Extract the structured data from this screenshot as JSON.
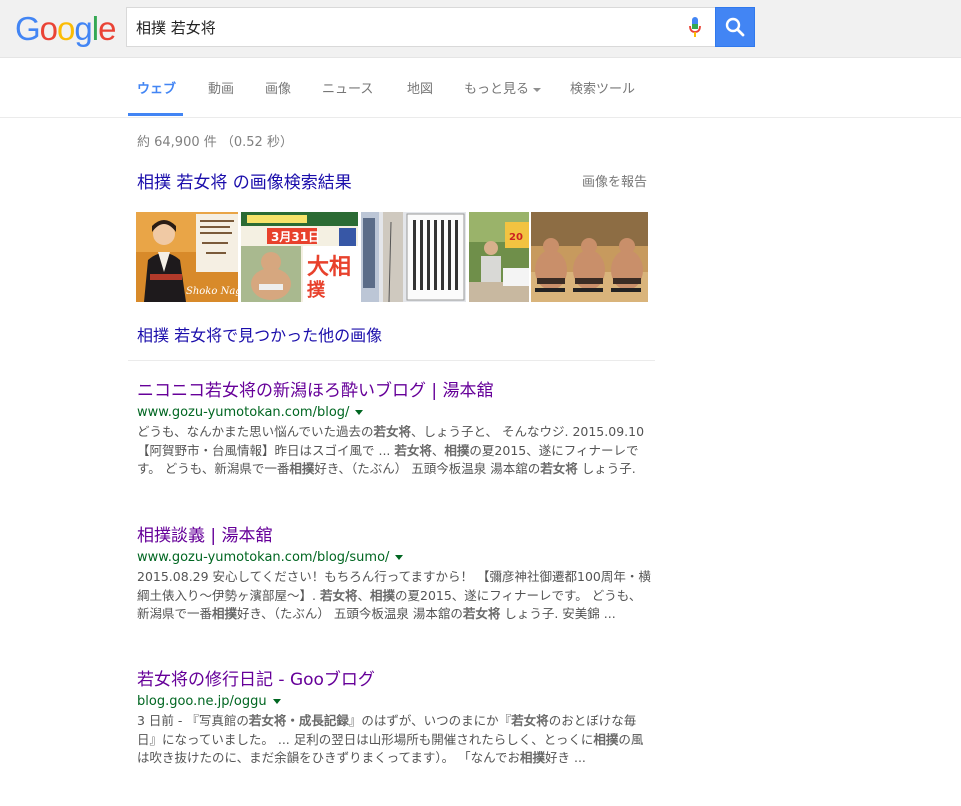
{
  "header": {
    "logo_letters": [
      "G",
      "o",
      "o",
      "g",
      "l",
      "e"
    ],
    "logo_colors": [
      "#4285f4",
      "#ea4335",
      "#fbbc05",
      "#4285f4",
      "#34a853",
      "#ea4335"
    ],
    "search_query": "相撲 若女将",
    "accent": "#4285f4"
  },
  "tabs": [
    {
      "label": "ウェブ",
      "active": true
    },
    {
      "label": "動画"
    },
    {
      "label": "画像"
    },
    {
      "label": "ニュース"
    },
    {
      "label": "地図"
    },
    {
      "label": "もっと見る"
    },
    {
      "label": "検索ツール"
    }
  ],
  "stats": "約 64,900 件 （0.52 秒）",
  "images": {
    "heading": "相撲 若女将 の画像検索結果",
    "report": "画像を報告",
    "more_link": "相撲 若女将で見つかった他の画像"
  },
  "results": [
    {
      "title": "ニコニコ若女将の新潟ほろ酔いブログ | 湯本舘",
      "url": "www.gozu-yumotokan.com/blog/",
      "snippet": [
        {
          "t": "どうも、なんかまた思い悩んでいた過去の"
        },
        {
          "t": "若女将",
          "b": true
        },
        {
          "t": "、しょう子と、 そんなウジ. 2015.09.10 【阿賀野市・台風情報】昨日はスゴイ風で ... "
        },
        {
          "t": "若女将",
          "b": true
        },
        {
          "t": "、"
        },
        {
          "t": "相撲",
          "b": true
        },
        {
          "t": "の夏2015、遂にフィナーレです。 どうも、新潟県で一番"
        },
        {
          "t": "相撲",
          "b": true
        },
        {
          "t": "好き、（たぶん） 五頭今板温泉 湯本舘の"
        },
        {
          "t": "若女将",
          "b": true
        },
        {
          "t": " しょう子."
        }
      ]
    },
    {
      "title": "相撲談義 | 湯本舘",
      "url": "www.gozu-yumotokan.com/blog/sumo/",
      "snippet": [
        {
          "t": "2015.08.29 安心してください！もちろん行ってますから！ 【彌彦神社御遷都100周年・横綱土俵入り〜伊勢ヶ濱部屋〜】. "
        },
        {
          "t": "若女将",
          "b": true
        },
        {
          "t": "、"
        },
        {
          "t": "相撲",
          "b": true
        },
        {
          "t": "の夏2015、遂にフィナーレです。 どうも、新潟県で一番"
        },
        {
          "t": "相撲",
          "b": true
        },
        {
          "t": "好き、（たぶん） 五頭今板温泉 湯本舘の"
        },
        {
          "t": "若女将",
          "b": true
        },
        {
          "t": " しょう子. 安美錦 ..."
        }
      ]
    },
    {
      "title": "若女将の修行日記 - Gooブログ",
      "url": "blog.goo.ne.jp/oggu",
      "snippet": [
        {
          "t": "3 日前 - 『写真館の"
        },
        {
          "t": "若女将・成長記録",
          "b": true
        },
        {
          "t": "』のはずが、いつのまにか『"
        },
        {
          "t": "若女将",
          "b": true
        },
        {
          "t": "のおとぼけな毎日』になっていました。 ... 足利の翌日は山形場所も開催されたらしく、とっくに"
        },
        {
          "t": "相撲",
          "b": true
        },
        {
          "t": "の風は吹き抜けたのに、まだ余韻をひきずりまくってます）。 「なんでお"
        },
        {
          "t": "相撲",
          "b": true
        },
        {
          "t": "好き ..."
        }
      ]
    }
  ]
}
